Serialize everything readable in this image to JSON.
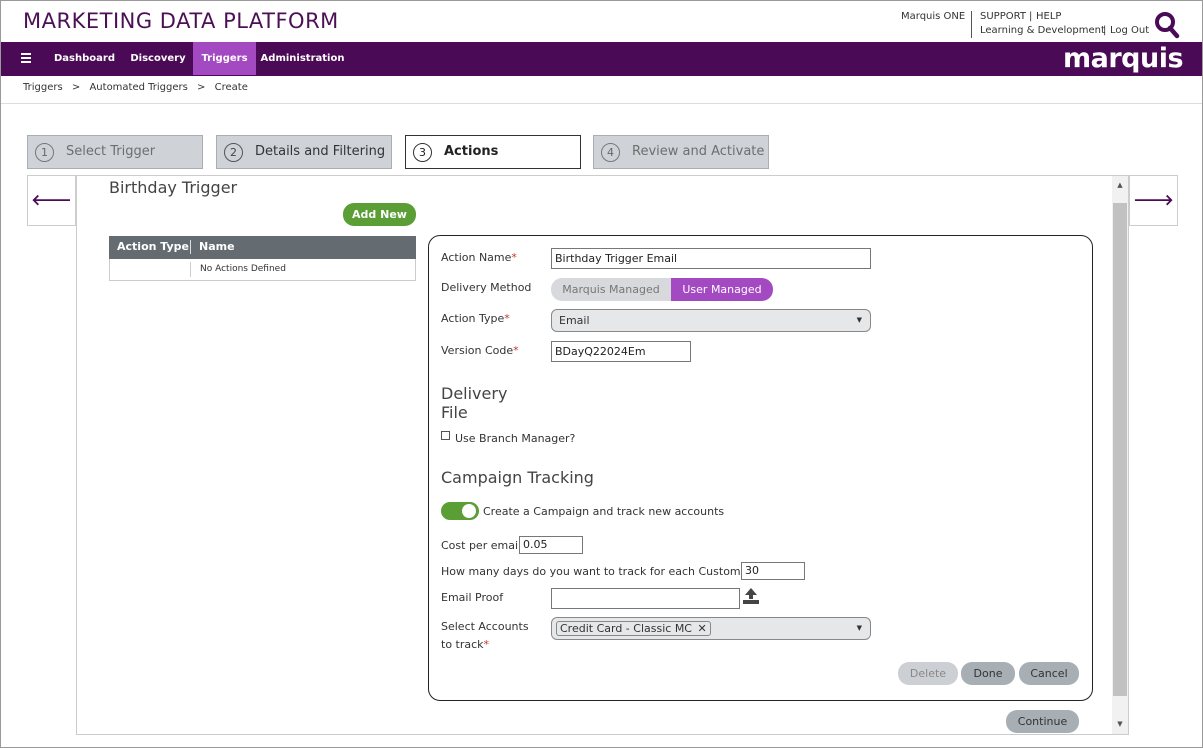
{
  "header": {
    "app_title": "MARKETING DATA PLATFORM",
    "marquis_one": "Marquis ONE",
    "support": "SUPPORT",
    "help": "HELP",
    "learning": "Learning & Development",
    "logout": "Log Out",
    "pipe": "|"
  },
  "nav": {
    "menu_icon": "hamburger-icon",
    "items": [
      "Dashboard",
      "Discovery",
      "Triggers",
      "Administration"
    ],
    "active": "Triggers",
    "brand": "marquis",
    "bg_color": "#4b0a56",
    "active_color": "#a349c2"
  },
  "breadcrumb": {
    "items": [
      "Triggers",
      "Automated Triggers",
      "Create"
    ],
    "separator": ">"
  },
  "steps": [
    {
      "num": "1",
      "label": "Select Trigger",
      "state": "inactive"
    },
    {
      "num": "2",
      "label": "Details and Filtering",
      "state": "done"
    },
    {
      "num": "3",
      "label": "Actions",
      "state": "active"
    },
    {
      "num": "4",
      "label": "Review and Activate",
      "state": "inactive"
    }
  ],
  "arrows": {
    "prev": "🡐",
    "next": "🡒"
  },
  "trigger": {
    "name": "Birthday Trigger",
    "add_new": "Add New"
  },
  "actions_table": {
    "columns": [
      "Action Type",
      "Name"
    ],
    "empty_text": "No Actions Defined"
  },
  "form": {
    "action_name_label": "Action Name",
    "action_name_value": "Birthday Trigger Email",
    "delivery_method_label": "Delivery Method",
    "delivery_options": [
      "Marquis Managed",
      "User Managed"
    ],
    "delivery_selected": "User Managed",
    "action_type_label": "Action Type",
    "action_type_value": "Email",
    "version_code_label": "Version Code",
    "version_code_value": "BDayQ22024Em",
    "delivery_file_heading_1": "Delivery",
    "delivery_file_heading_2": "File",
    "use_branch_manager_label": "Use Branch Manager?",
    "use_branch_manager_checked": false,
    "campaign_tracking_heading": "Campaign Tracking",
    "create_campaign_label": "Create a Campaign and track new accounts",
    "create_campaign_on": true,
    "cost_per_email_label": "Cost per email",
    "cost_per_email_value": "0.05",
    "days_track_label": "How many days do you want to track for each Customer?",
    "days_track_value": "30",
    "email_proof_label": "Email Proof",
    "email_proof_value": "",
    "upload_icon": "upload-icon",
    "select_accounts_label_1": "Select Accounts",
    "select_accounts_label_2": "to track",
    "selected_accounts": [
      "Credit Card - Classic MC"
    ],
    "required_mark": "*",
    "delete_label": "Delete",
    "done_label": "Done",
    "cancel_label": "Cancel"
  },
  "footer": {
    "continue_label": "Continue"
  },
  "colors": {
    "brand_purple": "#4b0a56",
    "accent_purple": "#a349c2",
    "green": "#5a9e35"
  }
}
